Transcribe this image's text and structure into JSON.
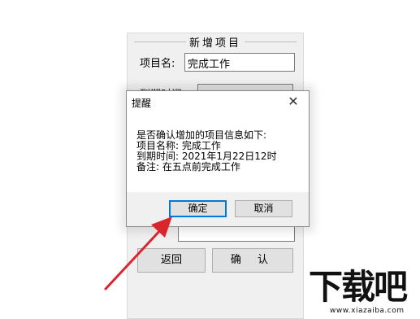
{
  "background_window": {
    "title": "新增项目",
    "project_name_label": "项目名:",
    "project_name_value": "完成工作",
    "due_time_label": "到期时间:",
    "back_button": "返回",
    "confirm_button": "确 认"
  },
  "dialog": {
    "title": "提醒",
    "close_icon": "close-icon",
    "message_lines": [
      "是否确认增加的项目信息如下:",
      "项目名称: 完成工作",
      "到期时间: 2021年1月22日12时",
      "备注: 在五点前完成工作"
    ],
    "ok_button": "确定",
    "cancel_button": "取消"
  },
  "watermark": {
    "text": "下载吧",
    "url": "www.xiazaiba.com"
  },
  "colors": {
    "arrow": "#d9262c",
    "focus_border": "#0078d7"
  }
}
